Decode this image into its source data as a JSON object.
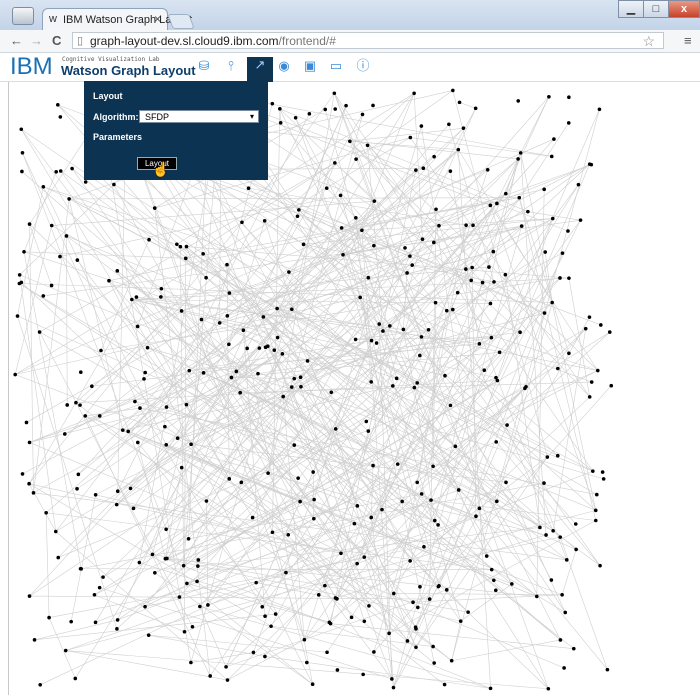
{
  "browser": {
    "tab_title": "IBM Watson Graph Layout",
    "tab_close": "×",
    "tab_favicon": "w",
    "url_host": "graph-layout-dev.sl.cloud9.ibm.com",
    "url_path": "/frontend/#",
    "back_glyph": "←",
    "forward_glyph": "→",
    "reload_glyph": "C",
    "star_glyph": "☆",
    "menu_glyph": "≡",
    "page_icon_glyph": "▯",
    "min_glyph": "▁",
    "max_glyph": "□",
    "close_glyph": "x"
  },
  "app": {
    "logo": "IBM",
    "lab_label": "Cognitive Visualization Lab",
    "title": "Watson Graph Layout",
    "toolbar_icons": [
      {
        "name": "database-icon",
        "glyph": "⛁"
      },
      {
        "name": "pin-icon",
        "glyph": "⫯"
      },
      {
        "name": "layout-tool-icon",
        "glyph": "↗",
        "active": true
      },
      {
        "name": "eye-icon",
        "glyph": "◉"
      },
      {
        "name": "image-icon",
        "glyph": "▣"
      },
      {
        "name": "monitor-icon",
        "glyph": "▭"
      },
      {
        "name": "info-icon",
        "glyph": "ⓘ"
      }
    ],
    "accent": "#1a6fb5",
    "panel_color": "#0c3352"
  },
  "panel": {
    "title": "Layout",
    "algorithm_label": "Algorithm:",
    "algorithm_value": "SFDP",
    "algorithm_caret": "▾",
    "parameters_label": "Parameters",
    "layout_button": "Layout"
  },
  "graph": {
    "node_color": "#000000",
    "edge_color": "#cfcfcf",
    "node_count": 420,
    "edge_count": 520
  }
}
